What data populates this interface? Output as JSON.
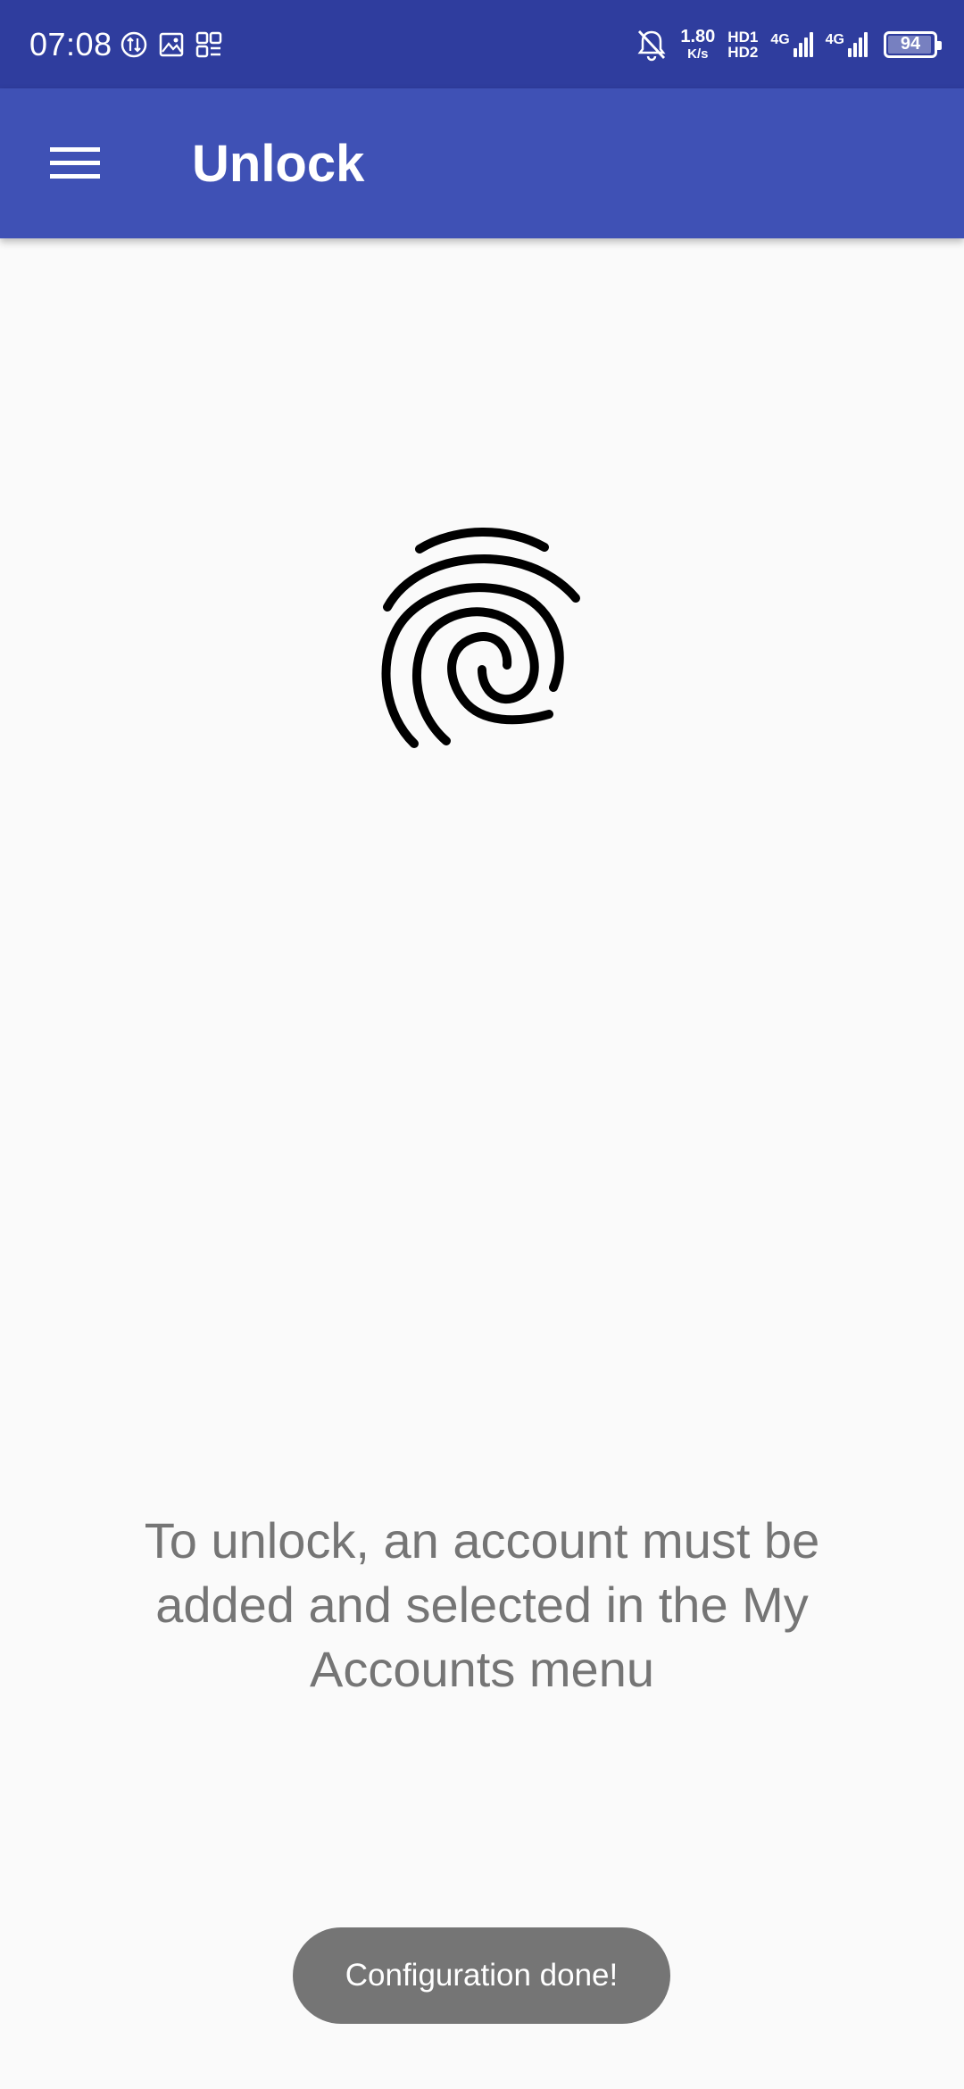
{
  "status_bar": {
    "time": "07:08",
    "net_speed_value": "1.80",
    "net_speed_unit": "K/s",
    "hd1": "HD1",
    "hd2": "HD2",
    "sim1_type": "4G",
    "sim2_type": "4G",
    "battery_level": "94"
  },
  "app_bar": {
    "title": "Unlock",
    "menu_icon": "hamburger-menu-icon"
  },
  "main": {
    "icon": "fingerprint-icon",
    "message": "To unlock, an account must be added and selected in the My Accounts menu"
  },
  "toast": {
    "text": "Configuration done!"
  },
  "colors": {
    "status_bar": "#2f3d9e",
    "app_bar": "#3f51b5",
    "background": "#fafafa",
    "message_text": "#757575",
    "toast_bg": "#757575"
  }
}
